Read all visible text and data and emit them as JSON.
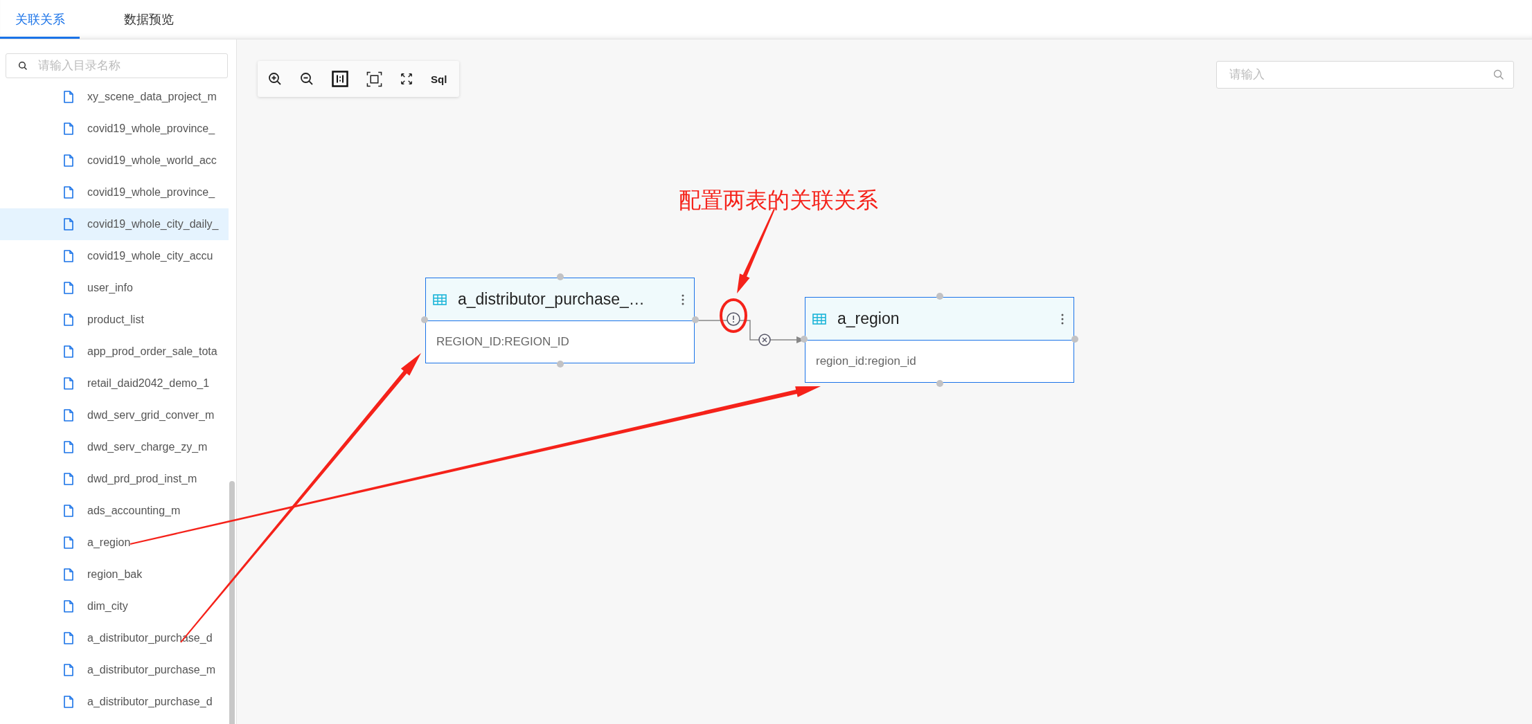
{
  "tabs": [
    {
      "label": "关联关系",
      "selected": true
    },
    {
      "label": "数据预览",
      "selected": false
    }
  ],
  "sidebar": {
    "search": {
      "placeholder": "请输入目录名称"
    },
    "items": [
      {
        "label": "xy_scene_data_project_m",
        "selected": false
      },
      {
        "label": "covid19_whole_province_",
        "selected": false
      },
      {
        "label": "covid19_whole_world_acc",
        "selected": false
      },
      {
        "label": "covid19_whole_province_",
        "selected": false
      },
      {
        "label": "covid19_whole_city_daily_",
        "selected": true
      },
      {
        "label": "covid19_whole_city_accu",
        "selected": false
      },
      {
        "label": "user_info",
        "selected": false
      },
      {
        "label": "product_list",
        "selected": false
      },
      {
        "label": "app_prod_order_sale_tota",
        "selected": false
      },
      {
        "label": "retail_daid2042_demo_1",
        "selected": false
      },
      {
        "label": "dwd_serv_grid_conver_m",
        "selected": false
      },
      {
        "label": "dwd_serv_charge_zy_m",
        "selected": false
      },
      {
        "label": "dwd_prd_prod_inst_m",
        "selected": false
      },
      {
        "label": "ads_accounting_m",
        "selected": false
      },
      {
        "label": "a_region",
        "selected": false
      },
      {
        "label": "region_bak",
        "selected": false
      },
      {
        "label": "dim_city",
        "selected": false
      },
      {
        "label": "a_distributor_purchase_d",
        "selected": false
      },
      {
        "label": "a_distributor_purchase_m",
        "selected": false
      },
      {
        "label": "a_distributor_purchase_d",
        "selected": false
      }
    ]
  },
  "canvas": {
    "toolbar": [
      {
        "kind": "zoom-in"
      },
      {
        "kind": "zoom-out"
      },
      {
        "kind": "actual-size"
      },
      {
        "kind": "fit"
      },
      {
        "kind": "fullscreen"
      },
      {
        "kind": "text",
        "label": "Sql"
      }
    ],
    "search": {
      "placeholder": "请输入"
    },
    "nodes": [
      {
        "title": "a_distributor_purchase_…",
        "fields": "REGION_ID:REGION_ID"
      },
      {
        "title": "a_region",
        "fields": "region_id:region_id"
      }
    ],
    "annotation": "配置两表的关联关系"
  }
}
